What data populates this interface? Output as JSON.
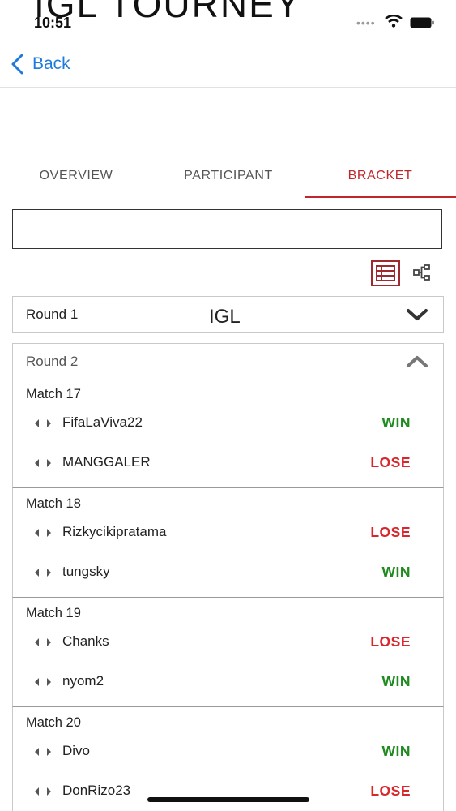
{
  "header": {
    "title": "IGL TOURNEY"
  },
  "status_bar": {
    "time": "10:51"
  },
  "nav": {
    "back_label": "Back"
  },
  "tabs": [
    {
      "label": "OVERVIEW",
      "active": false
    },
    {
      "label": "PARTICIPANT",
      "active": false
    },
    {
      "label": "BRACKET",
      "active": true
    }
  ],
  "search": {
    "value": "",
    "placeholder": ""
  },
  "view_toggle": {
    "selected": "list-view-icon",
    "other": "tree-view-icon"
  },
  "rounds": [
    {
      "label": "Round 1",
      "center_label": "IGL",
      "expanded": false,
      "icon": "chevron-down-icon"
    },
    {
      "label": "Round 2",
      "expanded": true,
      "icon": "chevron-up-icon"
    }
  ],
  "matches": [
    {
      "title": "Match 17",
      "players": [
        {
          "name": "FifaLaViva22",
          "result": "WIN"
        },
        {
          "name": "MANGGALER",
          "result": "LOSE"
        }
      ]
    },
    {
      "title": "Match 18",
      "players": [
        {
          "name": "Rizkycikipratama",
          "result": "LOSE"
        },
        {
          "name": "tungsky",
          "result": "WIN"
        }
      ]
    },
    {
      "title": "Match 19",
      "players": [
        {
          "name": "Chanks",
          "result": "LOSE"
        },
        {
          "name": "nyom2",
          "result": "WIN"
        }
      ]
    },
    {
      "title": "Match 20",
      "players": [
        {
          "name": "Divo",
          "result": "WIN"
        },
        {
          "name": "DonRizo23",
          "result": "LOSE"
        }
      ]
    }
  ],
  "colors": {
    "accent": "#c0272d",
    "link": "#1f7ae0",
    "win": "#1f8a1f",
    "lose": "#d8262b"
  }
}
